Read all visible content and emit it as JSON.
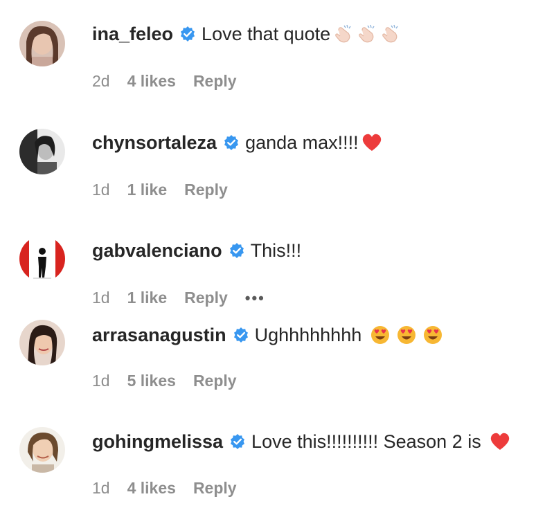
{
  "comments": [
    {
      "username": "ina_feleo",
      "text": "Love that quote",
      "time": "2d",
      "likes": "4 likes",
      "reply": "Reply",
      "emojis": [
        "clap-icon",
        "clap-icon",
        "clap-icon"
      ]
    },
    {
      "username": "chynsortaleza",
      "text": "ganda max!!!!",
      "time": "1d",
      "likes": "1 like",
      "reply": "Reply",
      "emojis": [
        "heart-icon"
      ]
    },
    {
      "username": "gabvalenciano",
      "text": "This!!!",
      "time": "1d",
      "likes": "1 like",
      "reply": "Reply",
      "more": "•••"
    },
    {
      "username": "arrasanagustin",
      "text": "Ughhhhhhhh",
      "time": "1d",
      "likes": "5 likes",
      "reply": "Reply",
      "emojis": [
        "heart-eyes-icon",
        "heart-eyes-icon",
        "heart-eyes-icon"
      ]
    },
    {
      "username": "gohingmelissa",
      "text": "Love this!!!!!!!!!! Season 2 is",
      "time": "1d",
      "likes": "4 likes",
      "reply": "Reply",
      "emojis": [
        "heart-icon"
      ]
    }
  ],
  "colors": {
    "verified": "#3897f0",
    "heart": "#ed3b3b",
    "meta": "#8e8e8e"
  }
}
